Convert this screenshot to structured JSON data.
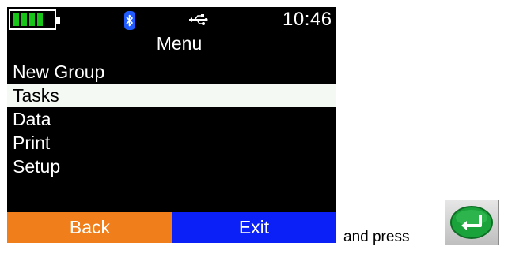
{
  "status_bar": {
    "battery_level": 4,
    "battery_icon": "battery-icon",
    "bluetooth_icon": "bluetooth-icon",
    "usb_icon": "usb-icon",
    "time": "10:46"
  },
  "title": "Menu",
  "menu": {
    "items": [
      {
        "label": "New Group",
        "selected": false
      },
      {
        "label": "Tasks",
        "selected": true
      },
      {
        "label": "Data",
        "selected": false
      },
      {
        "label": "Print",
        "selected": false
      },
      {
        "label": "Setup",
        "selected": false
      }
    ]
  },
  "softkeys": {
    "left": "Back",
    "right": "Exit"
  },
  "caption": "and press",
  "enter_key_icon": "enter-key-icon",
  "colors": {
    "screen_bg": "#000000",
    "battery_green": "#18c418",
    "bluetooth_blue": "#1f5bff",
    "back_orange": "#f07f1b",
    "exit_blue": "#0a20f6",
    "selection_bg": "#f4faf3",
    "enter_green": "#1aa33a"
  }
}
